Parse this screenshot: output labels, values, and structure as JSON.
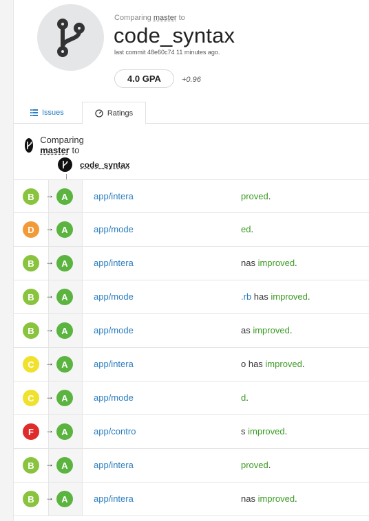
{
  "header": {
    "comparing_prefix": "Comparing",
    "base_branch": "master",
    "comparing_suffix": "to",
    "repo_title": "code_syntax",
    "last_commit": "last commit 48e60c74 11 minutes ago.",
    "gpa": "4.0 GPA",
    "gpa_delta": "+0.96"
  },
  "tabs": [
    {
      "label": "Issues",
      "icon": "list-icon",
      "active": false
    },
    {
      "label": "Ratings",
      "icon": "gauge-icon",
      "active": true
    }
  ],
  "compare": {
    "prefix": "Comparing",
    "base": "master",
    "suffix": "to",
    "head": "code_syntax"
  },
  "arrow_glyph": "→",
  "colors": {
    "A": "#5cb440",
    "B": "#8ac43f",
    "C": "#f0e12c",
    "D": "#f29a38",
    "F": "#e02b2b",
    "link": "#2a7dbf",
    "improved": "#3a9a22"
  },
  "rows": [
    {
      "from": "B",
      "to": "A",
      "path": "app/intera",
      "status_pre": "",
      "status_link": "",
      "status_mid": "",
      "status_imp": "proved",
      "status_end": "."
    },
    {
      "from": "D",
      "to": "A",
      "path": "app/mode",
      "status_pre": "",
      "status_link": "",
      "status_mid": "",
      "status_imp": "ed",
      "status_end": "."
    },
    {
      "from": "B",
      "to": "A",
      "path": "app/intera",
      "status_pre": "nas ",
      "status_link": "",
      "status_mid": "",
      "status_imp": "improved",
      "status_end": "."
    },
    {
      "from": "B",
      "to": "A",
      "path": "app/mode",
      "status_pre": "",
      "status_link": ".rb",
      "status_mid": " has ",
      "status_imp": "improved",
      "status_end": "."
    },
    {
      "from": "B",
      "to": "A",
      "path": "app/mode",
      "status_pre": "as ",
      "status_link": "",
      "status_mid": "",
      "status_imp": "improved",
      "status_end": "."
    },
    {
      "from": "C",
      "to": "A",
      "path": "app/intera",
      "status_pre": "",
      "status_link": "",
      "status_mid": "o has ",
      "status_imp": "improved",
      "status_end": "."
    },
    {
      "from": "C",
      "to": "A",
      "path": "app/mode",
      "status_pre": "",
      "status_link": "",
      "status_mid": "",
      "status_imp": "d",
      "status_end": "."
    },
    {
      "from": "F",
      "to": "A",
      "path": "app/contro",
      "status_pre": "s ",
      "status_link": "",
      "status_mid": "",
      "status_imp": "improved",
      "status_end": "."
    },
    {
      "from": "B",
      "to": "A",
      "path": "app/intera",
      "status_pre": "",
      "status_link": "",
      "status_mid": "",
      "status_imp": "proved",
      "status_end": "."
    },
    {
      "from": "B",
      "to": "A",
      "path": "app/intera",
      "status_pre": "nas ",
      "status_link": "",
      "status_mid": "",
      "status_imp": "improved",
      "status_end": "."
    }
  ]
}
